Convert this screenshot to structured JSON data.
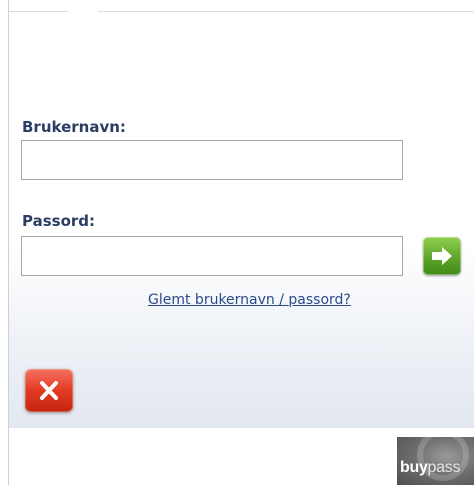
{
  "login_form": {
    "username_label": "Brukernavn:",
    "username_value": "",
    "password_label": "Passord:",
    "password_value": "",
    "forgot_link": "Glemt brukernavn / passord?",
    "go_icon": "arrow-right-icon",
    "close_icon": "close-x-icon"
  },
  "footer": {
    "logo_bold": "buy",
    "logo_light": "pass"
  },
  "colors": {
    "label": "#2b3e63",
    "link": "#2a4a8a",
    "go_button": "#5fa52a",
    "close_button": "#e23a23"
  }
}
